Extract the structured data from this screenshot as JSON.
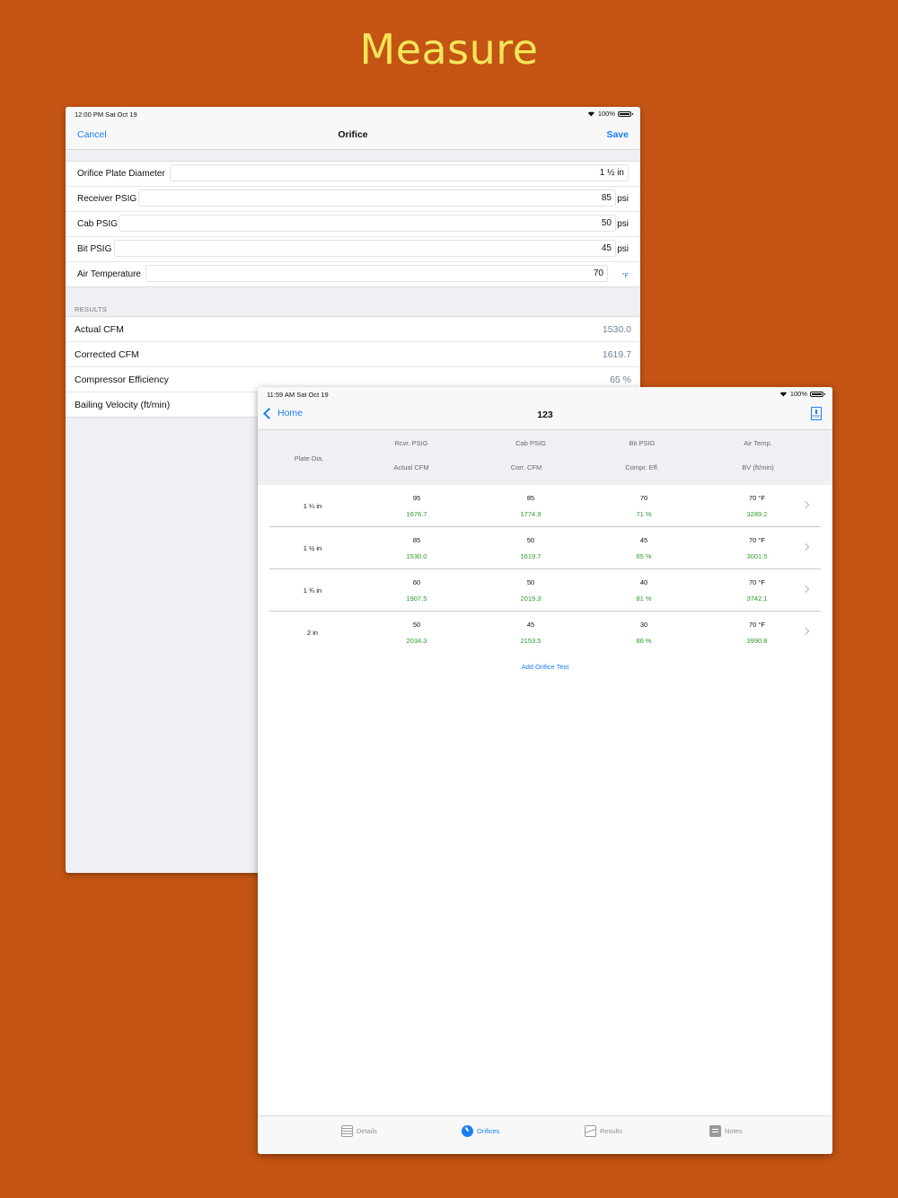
{
  "headline": "Measure",
  "back_window": {
    "status": {
      "time": "12:00 PM   Sat Oct 19",
      "battery": "100%"
    },
    "nav": {
      "cancel": "Cancel",
      "title": "Orifice",
      "save": "Save"
    },
    "fields": [
      {
        "label": "Orifice Plate Diameter",
        "value": "1 ½ in",
        "unit": ""
      },
      {
        "label": "Receiver PSIG",
        "value": "85",
        "unit": "psi"
      },
      {
        "label": "Cab PSIG",
        "value": "50",
        "unit": "psi"
      },
      {
        "label": "Bit PSIG",
        "value": "45",
        "unit": "psi"
      },
      {
        "label": "Air Temperature",
        "value": "70",
        "unit": "°F"
      }
    ],
    "results_header": "RESULTS",
    "results": [
      {
        "label": "Actual CFM",
        "value": "1530.0"
      },
      {
        "label": "Corrected CFM",
        "value": "1619.7"
      },
      {
        "label": "Compressor Efficiency",
        "value": "65 %"
      },
      {
        "label": "Bailing Velocity (ft/min)",
        "value": ""
      }
    ]
  },
  "front_window": {
    "status": {
      "time": "11:59 AM   Sat Oct 19",
      "battery": "100%"
    },
    "nav": {
      "back": "Home",
      "title": "123",
      "pdf_icon": "pdf-export-icon"
    },
    "columns": {
      "plate": "Plate Dia.",
      "top": [
        "Rcvr. PSIG",
        "Cab PSIG",
        "Bit PSIG",
        "Air Temp."
      ],
      "bottom": [
        "Actual CFM",
        "Corr. CFM",
        "Compr. Eff.",
        "BV (ft/min)"
      ]
    },
    "rows": [
      {
        "plate": "1 ¼ in",
        "top": [
          "95",
          "85",
          "70",
          "70 °F"
        ],
        "bottom": [
          "1676.7",
          "1774.9",
          "71 %",
          "3289.2"
        ]
      },
      {
        "plate": "1 ½ in",
        "top": [
          "85",
          "50",
          "45",
          "70 °F"
        ],
        "bottom": [
          "1530.0",
          "1619.7",
          "65 %",
          "3001.5"
        ]
      },
      {
        "plate": "1 ¾ in",
        "top": [
          "60",
          "50",
          "40",
          "70 °F"
        ],
        "bottom": [
          "1907.5",
          "2019.3",
          "81 %",
          "3742.1"
        ]
      },
      {
        "plate": "2  in",
        "top": [
          "50",
          "45",
          "30",
          "70 °F"
        ],
        "bottom": [
          "2034.3",
          "2153.5",
          "86 %",
          "3990.8"
        ]
      }
    ],
    "add_button": "Add Orifice Test",
    "tabs": [
      {
        "label": "Details",
        "icon": "details-icon"
      },
      {
        "label": "Orifices",
        "icon": "orifices-icon",
        "active": true
      },
      {
        "label": "Results",
        "icon": "results-icon"
      },
      {
        "label": "Notes",
        "icon": "notes-icon"
      }
    ]
  },
  "colors": {
    "background": "#c35413",
    "headline": "#f4e55a",
    "accent": "#1a7cf5",
    "positive": "#2a9c2a"
  }
}
